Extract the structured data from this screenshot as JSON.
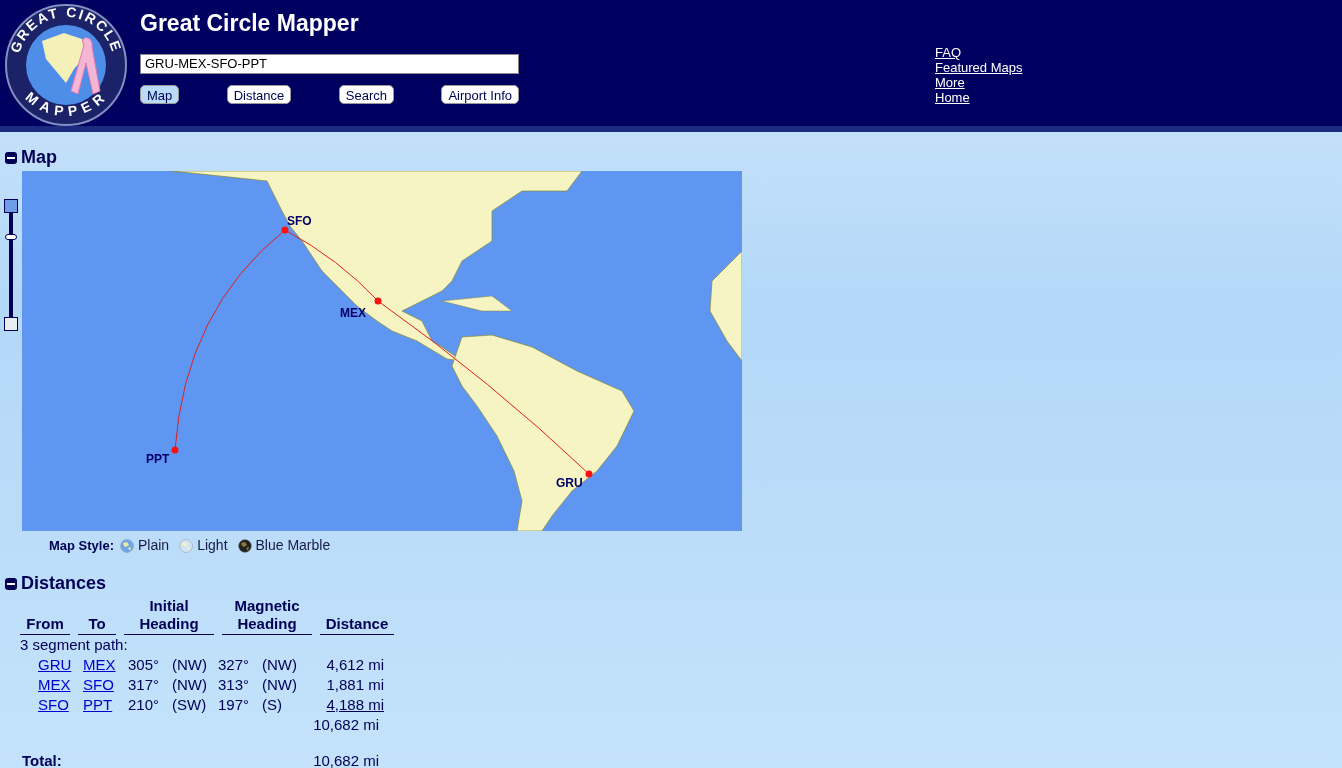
{
  "header": {
    "title": "Great Circle Mapper",
    "logo_text": "GREAT CIRCLE",
    "logo_text_bottom": "MAPPER",
    "route_input": "GRU-MEX-SFO-PPT",
    "buttons": [
      {
        "label": "Map",
        "selected": true
      },
      {
        "label": "Distance",
        "selected": false
      },
      {
        "label": "Search",
        "selected": false
      },
      {
        "label": "Airport Info",
        "selected": false
      }
    ],
    "links": [
      "FAQ",
      "Featured Maps",
      "More",
      "Home"
    ]
  },
  "map_section": {
    "title": "Map",
    "expanded": true,
    "zoom": {
      "level": 0.75
    },
    "airports": [
      {
        "code": "GRU"
      },
      {
        "code": "MEX"
      },
      {
        "code": "SFO"
      },
      {
        "code": "PPT"
      }
    ],
    "style_label": "Map Style:",
    "styles": [
      {
        "label": "Plain",
        "kind": "plain"
      },
      {
        "label": "Light",
        "kind": "light"
      },
      {
        "label": "Blue Marble",
        "kind": "marble"
      }
    ]
  },
  "distances_section": {
    "title": "Distances",
    "expanded": true,
    "columns": [
      {
        "line2": "From"
      },
      {
        "line2": "To"
      },
      {
        "line1": "Initial",
        "line2": "Heading"
      },
      {
        "line1": "Magnetic",
        "line2": "Heading"
      },
      {
        "line2": "Distance"
      }
    ],
    "path_label": "3 segment path:",
    "rows": [
      {
        "from": "GRU",
        "to": "MEX",
        "initial": "305°",
        "initial_dir": "(NW)",
        "magnetic": "327°",
        "magnetic_dir": "(NW)",
        "distance": "4,612 mi",
        "underlined": false
      },
      {
        "from": "MEX",
        "to": "SFO",
        "initial": "317°",
        "initial_dir": "(NW)",
        "magnetic": "313°",
        "magnetic_dir": "(NW)",
        "distance": "1,881 mi",
        "underlined": false
      },
      {
        "from": "SFO",
        "to": "PPT",
        "initial": "210°",
        "initial_dir": "(SW)",
        "magnetic": "197°",
        "magnetic_dir": "(S)",
        "distance": "4,188 mi",
        "underlined": true
      }
    ],
    "subtotal": "10,682 mi",
    "total_label": "Total:",
    "total": "10,682 mi"
  }
}
